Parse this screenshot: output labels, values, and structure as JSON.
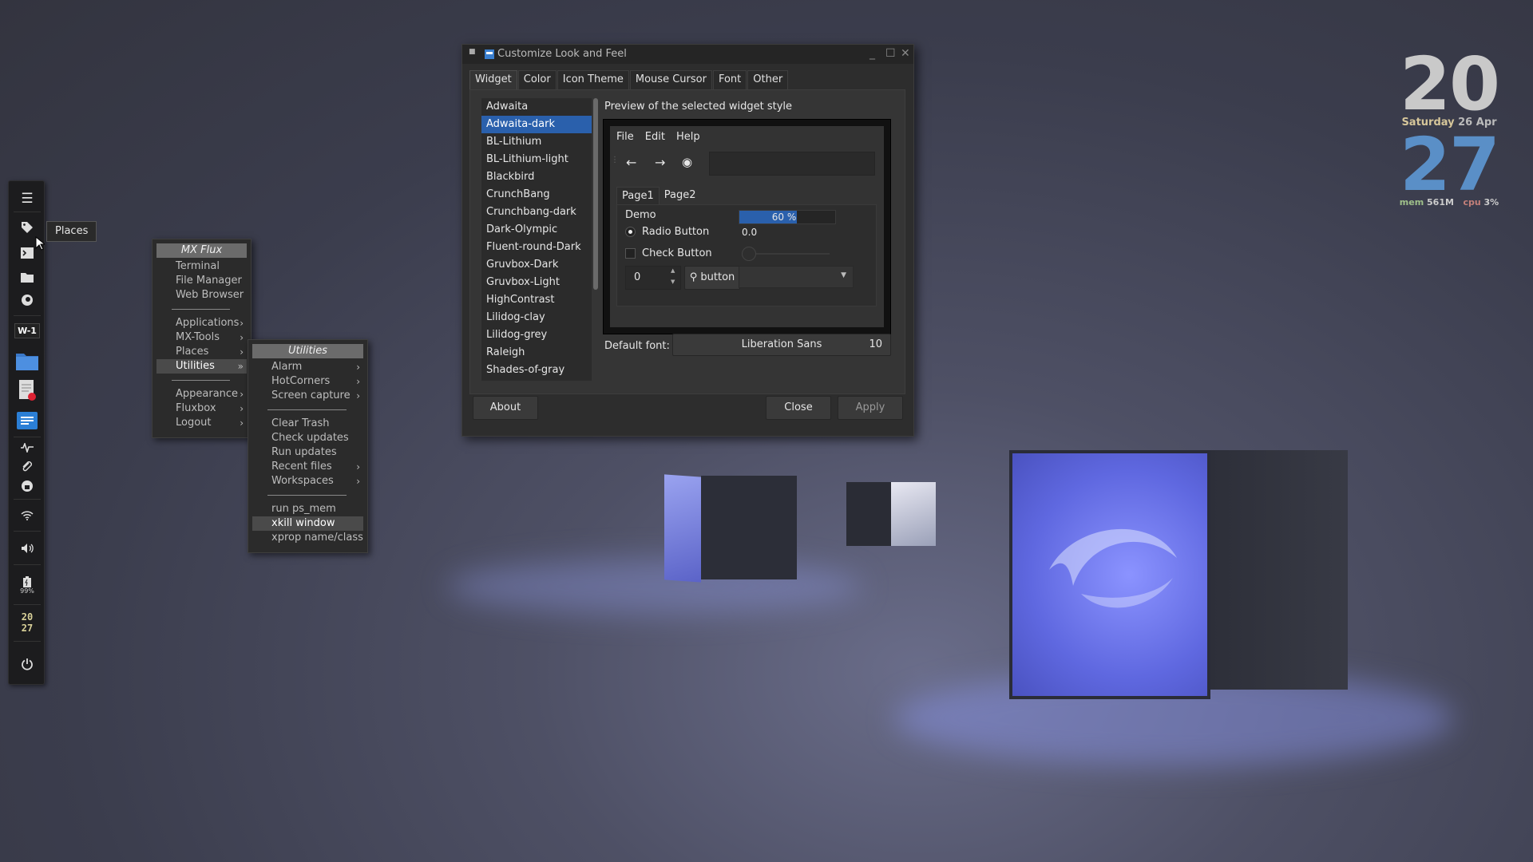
{
  "dock": {
    "workspace_label": "W-1",
    "battery_percent": "99%",
    "clock_hour": "20",
    "clock_minute": "27"
  },
  "tooltip": "Places",
  "mxflux_menu": {
    "title": "MX Flux",
    "group1": [
      "Terminal",
      "File Manager",
      "Web Browser"
    ],
    "group2": [
      {
        "label": "Applications",
        "submenu": true
      },
      {
        "label": "MX-Tools",
        "submenu": true
      },
      {
        "label": "Places",
        "submenu": true
      },
      {
        "label": "Utilities",
        "submenu": true,
        "active": true
      }
    ],
    "group3": [
      {
        "label": "Appearance",
        "submenu": true
      },
      {
        "label": "Fluxbox",
        "submenu": true
      },
      {
        "label": "Logout",
        "submenu": true
      }
    ]
  },
  "utilities_menu": {
    "title": "Utilities",
    "group1": [
      {
        "label": "Alarm",
        "submenu": true
      },
      {
        "label": "HotCorners",
        "submenu": true
      },
      {
        "label": "Screen capture",
        "submenu": true
      }
    ],
    "group2": [
      {
        "label": "Clear Trash"
      },
      {
        "label": "Check updates"
      },
      {
        "label": "Run updates"
      },
      {
        "label": "Recent files",
        "submenu": true
      },
      {
        "label": "Workspaces",
        "submenu": true
      }
    ],
    "group3": [
      {
        "label": "run ps_mem"
      },
      {
        "label": "xkill window",
        "active": true
      },
      {
        "label": "xprop name/class"
      }
    ]
  },
  "dialog": {
    "title": "Customize Look and Feel",
    "tabs": [
      "Widget",
      "Color",
      "Icon Theme",
      "Mouse Cursor",
      "Font",
      "Other"
    ],
    "active_tab": "Widget",
    "themes": [
      "Adwaita",
      "Adwaita-dark",
      "BL-Lithium",
      "BL-Lithium-light",
      "Blackbird",
      "CrunchBang",
      "Crunchbang-dark",
      "Dark-Olympic",
      "Fluent-round-Dark",
      "Gruvbox-Dark",
      "Gruvbox-Light",
      "HighContrast",
      "Lilidog-clay",
      "Lilidog-grey",
      "Raleigh",
      "Shades-of-gray"
    ],
    "selected_theme": "Adwaita-dark",
    "preview_label": "Preview of the selected widget style",
    "preview": {
      "menu": [
        "File",
        "Edit",
        "Help"
      ],
      "tabs": [
        "Page1",
        "Page2"
      ],
      "demo_label": "Demo",
      "radio_label": "Radio Button",
      "check_label": "Check Button",
      "progress_text": "60 %",
      "progress_value": 0.6,
      "scale_value": "0.0",
      "spin_value": "0",
      "button_label": "button"
    },
    "default_font_label": "Default font:",
    "font_name": "Liberation Sans",
    "font_size": "10",
    "buttons": {
      "about": "About",
      "close": "Close",
      "apply": "Apply"
    }
  },
  "conky": {
    "hour": "20",
    "minute": "27",
    "day": "Saturday",
    "date": "26 Apr",
    "mem_label": "mem",
    "mem_value": "561M",
    "cpu_label": "cpu",
    "cpu_value": "3%",
    "colors": {
      "hour": "#c9c9c9",
      "minute": "#5a8fc7",
      "day": "#d6c69a",
      "mem_label": "#9fc08a",
      "cpu_label": "#c4807a"
    }
  }
}
